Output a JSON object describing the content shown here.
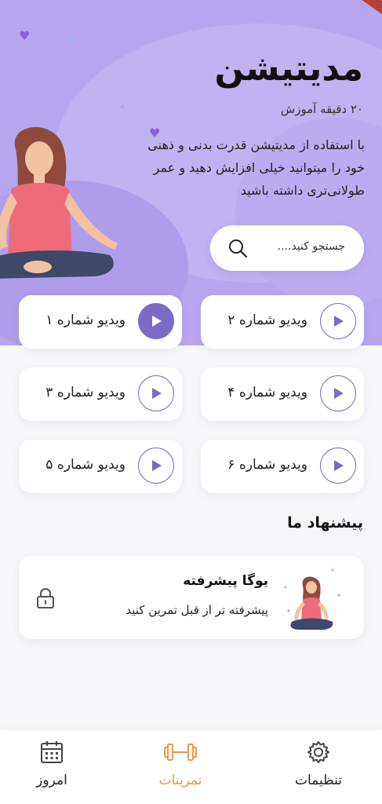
{
  "header": {
    "title": "مدیتیشن",
    "subtitle": "۲۰ دقیقه آموزش",
    "description": "با استفاده از مدیتیشن قدرت بدنی و ذهنی خود را میتوانید خیلی افزایش دهید و عمر طولانی‌تری داشته باشید"
  },
  "search": {
    "placeholder": "جستجو کنید....",
    "icon": "search-icon"
  },
  "videos": [
    {
      "label": "ویدیو شماره ۲",
      "selected": false
    },
    {
      "label": "ویدیو شماره ۱",
      "selected": true
    },
    {
      "label": "ویدیو شماره ۴",
      "selected": false
    },
    {
      "label": "ویدیو شماره ۳",
      "selected": false
    },
    {
      "label": "ویدیو شماره ۶",
      "selected": false
    },
    {
      "label": "ویدیو شماره ۵",
      "selected": false
    }
  ],
  "recommend": {
    "section_title": "پیشنهاد ما",
    "card_title": "یوگا پیشرفته",
    "card_subtitle": "پیشرفته تر از قبل تمرین کنید",
    "locked": true
  },
  "nav": [
    {
      "label": "تنظیمات",
      "icon": "gear-icon",
      "active": false
    },
    {
      "label": "تمرینات",
      "icon": "dumbbell-icon",
      "active": true
    },
    {
      "label": "امروز",
      "icon": "calendar-icon",
      "active": false
    }
  ],
  "colors": {
    "hero_bg": "#b7a6ee",
    "accent": "#7b6bc6",
    "active_nav": "#e39a4b"
  }
}
